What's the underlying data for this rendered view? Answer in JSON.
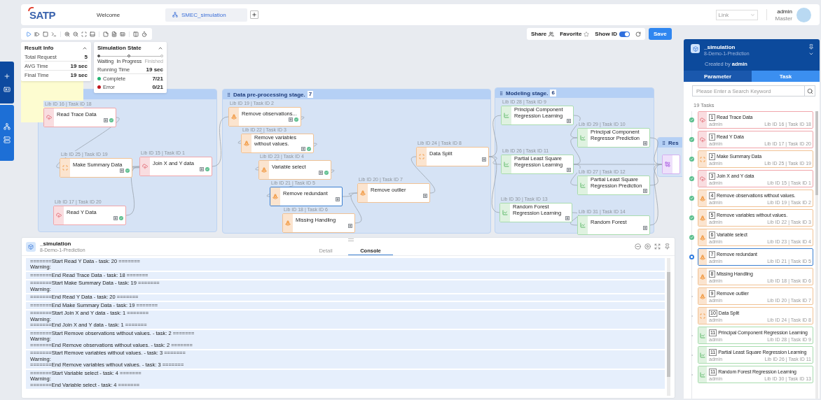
{
  "header": {
    "logo": "SATP",
    "tabs": [
      {
        "label": "Welcome",
        "selected": false
      },
      {
        "label": "SMEC_simulation",
        "selected": true
      }
    ],
    "link_select": {
      "placeholder": "Link"
    },
    "user": {
      "name": "admin",
      "role": "Master"
    }
  },
  "toolbar_actions": {
    "share": "Share",
    "favorite": "Favorite",
    "show_id": {
      "label": "Show ID",
      "on": true
    },
    "save": "Save"
  },
  "result_info": {
    "title": "Result Info",
    "rows": [
      {
        "label": "Total Request",
        "value": "5"
      },
      {
        "label": "AVG Time",
        "value": "19 sec"
      },
      {
        "label": "Final Time",
        "value": "19 sec"
      }
    ]
  },
  "simulation_state": {
    "title": "Simulation State",
    "steps": [
      {
        "label": "Waiting",
        "done": true,
        "current": false
      },
      {
        "label": "In Progress",
        "done": false,
        "current": true
      },
      {
        "label": "Finished",
        "done": false,
        "current": false
      }
    ],
    "running_time": {
      "label": "Running Time",
      "value": "19 sec"
    },
    "counts": [
      {
        "label": "Complete",
        "value": "7/21",
        "color": "#22b573"
      },
      {
        "label": "Error",
        "value": "0/21",
        "color": "#c0161c"
      }
    ]
  },
  "stages": [
    {
      "nodes": [
        {
          "label": "Lib ID 16 | Task ID 18",
          "name": "Read Trace Data",
          "kind": "load",
          "done": true,
          "selected": false
        },
        {
          "label": "Lib ID 25 | Task ID 19",
          "name": "Make Summary Data",
          "kind": "summary",
          "done": true,
          "selected": false
        },
        {
          "label": "Lib ID 15 | Task ID 1",
          "name": "Join X and Y data",
          "kind": "load",
          "done": true,
          "selected": false
        },
        {
          "label": "Lib ID 17 | Task ID 20",
          "name": "Read Y Data",
          "kind": "load",
          "done": true,
          "selected": false
        }
      ]
    },
    {
      "title": "Data pre-processing stage.",
      "count": "7",
      "nodes": [
        {
          "label": "Lib ID 19 | Task ID 2",
          "name": "Remove observations...",
          "kind": "clean",
          "done": true,
          "selected": false
        },
        {
          "label": "Lib ID 22 | Task ID 3",
          "name": "Remove variables without values.",
          "kind": "clean",
          "done": true,
          "selected": false
        },
        {
          "label": "Lib ID 23 | Task ID 4",
          "name": "Variable select",
          "kind": "clean",
          "done": true,
          "selected": false
        },
        {
          "label": "Lib ID 21 | Task ID 5",
          "name": "Remove redundant",
          "kind": "clean",
          "done": false,
          "selected": true
        },
        {
          "label": "Lib ID 18 | Task ID 6",
          "name": "Missing Handling",
          "kind": "clean",
          "done": false,
          "selected": false
        },
        {
          "label": "Lib ID 20 | Task ID 7",
          "name": "Remove outlier",
          "kind": "clean",
          "done": false,
          "selected": false
        },
        {
          "label": "Lib ID 24 | Task ID 8",
          "name": "Data Split",
          "kind": "summary",
          "done": false,
          "selected": false
        }
      ]
    },
    {
      "title": "Modeling stage.",
      "count": "6",
      "nodes": [
        {
          "label": "Lib ID 28 | Task ID 9",
          "name": "Principal Component Regression Learning",
          "kind": "model",
          "done": false,
          "selected": false
        },
        {
          "label": "Lib ID 29 | Task ID 10",
          "name": "Principal Component Regressor Prediction",
          "kind": "model",
          "done": false,
          "selected": false
        },
        {
          "label": "Lib ID 26 | Task ID 11",
          "name": "Partial Least Square Regression Learning",
          "kind": "model",
          "done": false,
          "selected": false
        },
        {
          "label": "Lib ID 27 | Task ID 12",
          "name": "Partial Least Square Regression Prediction",
          "kind": "model",
          "done": false,
          "selected": false
        },
        {
          "label": "Lib ID 30 | Task ID 13",
          "name": "Random Forest Regression Learning",
          "kind": "model",
          "done": false,
          "selected": false
        },
        {
          "label": "Lib ID 31 | Task ID 14",
          "name": "Random Forest",
          "kind": "model",
          "done": false,
          "selected": false
        }
      ]
    },
    {
      "title": "Res",
      "nodes": [
        {
          "kind": "result",
          "selected": false
        }
      ]
    }
  ],
  "console": {
    "title": "_simulation",
    "subtitle": "8-Demo-1-Prediction",
    "tabs": [
      {
        "label": "Detail",
        "selected": false
      },
      {
        "label": "Console",
        "selected": true
      }
    ],
    "log": [
      [
        "=======Start Read Y Data - task: 20 =======",
        "Warning:"
      ],
      [
        "=======End Read Trace Data - task: 18 ======="
      ],
      [
        "=======Start Make Summary Data - task: 19 =======",
        "Warning:"
      ],
      [
        "=======End Read Y Data - task: 20 ======="
      ],
      [
        "=======End Make Summary Data - task: 19 ======="
      ],
      [
        "=======Start Join X and Y data - task: 1 =======",
        "Warning:",
        "=======End Join X and Y data - task: 1 ======="
      ],
      [
        "=======Start Remove observations without values. - task: 2 =======",
        "Warning:",
        "=======End Remove observations without values. - task: 2 ======="
      ],
      [
        "=======Start Remove variables without values. - task: 3 =======",
        "Warning:",
        "=======End Remove variables without values. - task: 3 ======="
      ],
      [
        "=======Start Variable select - task: 4 =======",
        "Warning:",
        "=======End Variable select - task: 4 ======="
      ]
    ]
  },
  "task_panel": {
    "title": "_simulation",
    "subtitle": "8-Demo-1-Prediction",
    "created_by": "Created by **admin**",
    "tabs": [
      {
        "label": "Parameter",
        "selected": false
      },
      {
        "label": "Task",
        "selected": true
      }
    ],
    "search": {
      "placeholder": "Please Enter a Search Keyword"
    },
    "count": "19 Tasks",
    "tasks": [
      {
        "step": "1",
        "name": "Read Trace Data",
        "owner": "admin",
        "ids": "Lib ID 16 | Task ID 18",
        "kind": "load",
        "done": true,
        "running": false,
        "selected": false
      },
      {
        "step": "1",
        "name": "Read Y Data",
        "owner": "admin",
        "ids": "Lib ID 17 | Task ID 20",
        "kind": "load",
        "done": true,
        "running": false,
        "selected": false
      },
      {
        "step": "2",
        "name": "Make Summary Data",
        "owner": "admin",
        "ids": "Lib ID 25 | Task ID 19",
        "kind": "summary",
        "done": true,
        "running": false,
        "selected": false
      },
      {
        "step": "3",
        "name": "Join X and Y data",
        "owner": "admin",
        "ids": "Lib ID 15 | Task ID 1",
        "kind": "load",
        "done": true,
        "running": false,
        "selected": false
      },
      {
        "step": "4",
        "name": "Remove observations without values.",
        "owner": "admin",
        "ids": "Lib ID 19 | Task ID 2",
        "kind": "clean",
        "done": true,
        "running": false,
        "selected": false
      },
      {
        "step": "5",
        "name": "Remove variables without values.",
        "owner": "admin",
        "ids": "Lib ID 22 | Task ID 3",
        "kind": "clean",
        "done": true,
        "running": false,
        "selected": false
      },
      {
        "step": "6",
        "name": "Variable select",
        "owner": "admin",
        "ids": "Lib ID 23 | Task ID 4",
        "kind": "clean",
        "done": true,
        "running": false,
        "selected": false
      },
      {
        "step": "7",
        "name": "Remove redundant",
        "owner": "admin",
        "ids": "Lib ID 21 | Task ID 5",
        "kind": "clean",
        "done": false,
        "running": true,
        "selected": true
      },
      {
        "step": "8",
        "name": "Missing Handling",
        "owner": "admin",
        "ids": "Lib ID 18 | Task ID 6",
        "kind": "clean",
        "done": false,
        "running": false,
        "selected": false
      },
      {
        "step": "9",
        "name": "Remove outlier",
        "owner": "admin",
        "ids": "Lib ID 20 | Task ID 7",
        "kind": "clean",
        "done": false,
        "running": false,
        "selected": false
      },
      {
        "step": "10",
        "name": "Data Split",
        "owner": "admin",
        "ids": "Lib ID 24 | Task ID 8",
        "kind": "summary",
        "done": false,
        "running": false,
        "selected": false
      },
      {
        "step": "11",
        "name": "Principal Component Regression Learning",
        "owner": "admin",
        "ids": "Lib ID 28 | Task ID 9",
        "kind": "model",
        "done": false,
        "running": false,
        "selected": false
      },
      {
        "step": "11",
        "name": "Partial Least Square Regression Learning",
        "owner": "admin",
        "ids": "Lib ID 26 | Task ID 11",
        "kind": "model",
        "done": false,
        "running": false,
        "selected": false
      },
      {
        "step": "11",
        "name": "Random Forest Regression Learning",
        "owner": "admin",
        "ids": "Lib ID 30 | Task ID 13",
        "kind": "model",
        "done": false,
        "running": false,
        "selected": false
      }
    ]
  }
}
